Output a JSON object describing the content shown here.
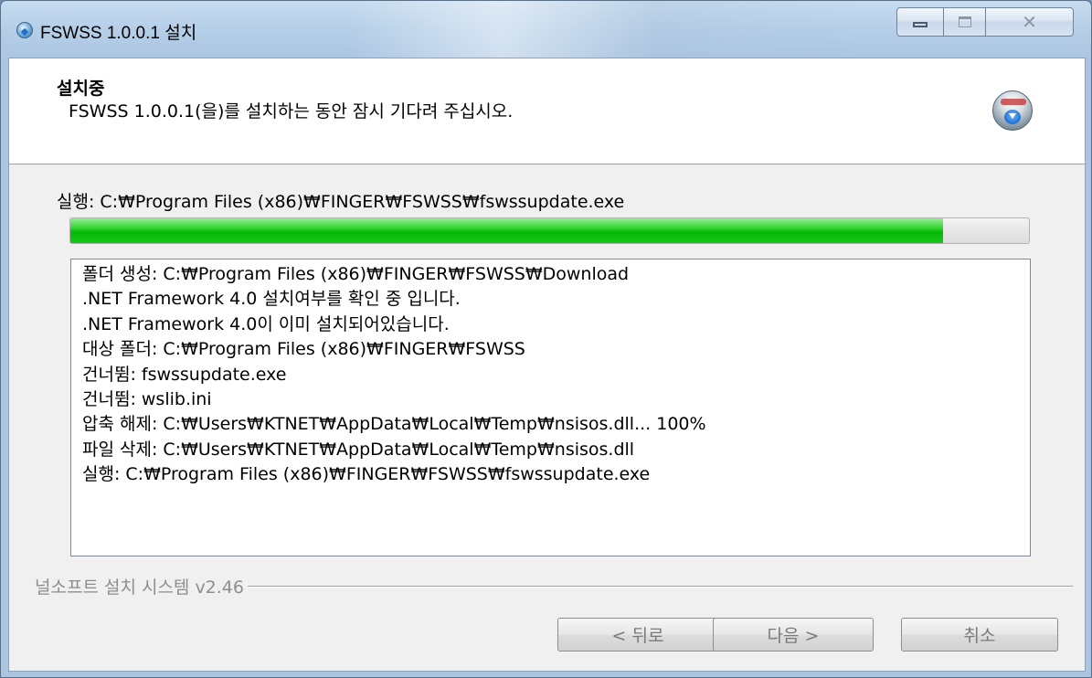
{
  "window": {
    "title": "FSWSS 1.0.0.1 설치"
  },
  "header": {
    "title": "설치중",
    "subtitle": "FSWSS 1.0.0.1(을)를 설치하는 동안 잠시 기다려 주십시오."
  },
  "status": {
    "exec_label": "실행: C:₩Program Files (x86)₩FINGER₩FSWSS₩fswssupdate.exe",
    "progress": 0.91
  },
  "log": {
    "lines": [
      "폴더 생성: C:₩Program Files (x86)₩FINGER₩FSWSS₩Download",
      ".NET Framework 4.0 설치여부를 확인 중 입니다.",
      ".NET Framework 4.0이 이미 설치되어있습니다.",
      "대상 폴더: C:₩Program Files (x86)₩FINGER₩FSWSS",
      "건너뜀: fswssupdate.exe",
      "건너뜀: wslib.ini",
      "압축 해제: C:₩Users₩KTNET₩AppData₩Local₩Temp₩nsisos.dll... 100%",
      "파일 삭제: C:₩Users₩KTNET₩AppData₩Local₩Temp₩nsisos.dll",
      "실행: C:₩Program Files (x86)₩FINGER₩FSWSS₩fswssupdate.exe"
    ]
  },
  "footer": {
    "brand": "널소프트 설치 시스템 v2.46",
    "back_label": "< 뒤로",
    "next_label": "다음 >",
    "cancel_label": "취소"
  }
}
